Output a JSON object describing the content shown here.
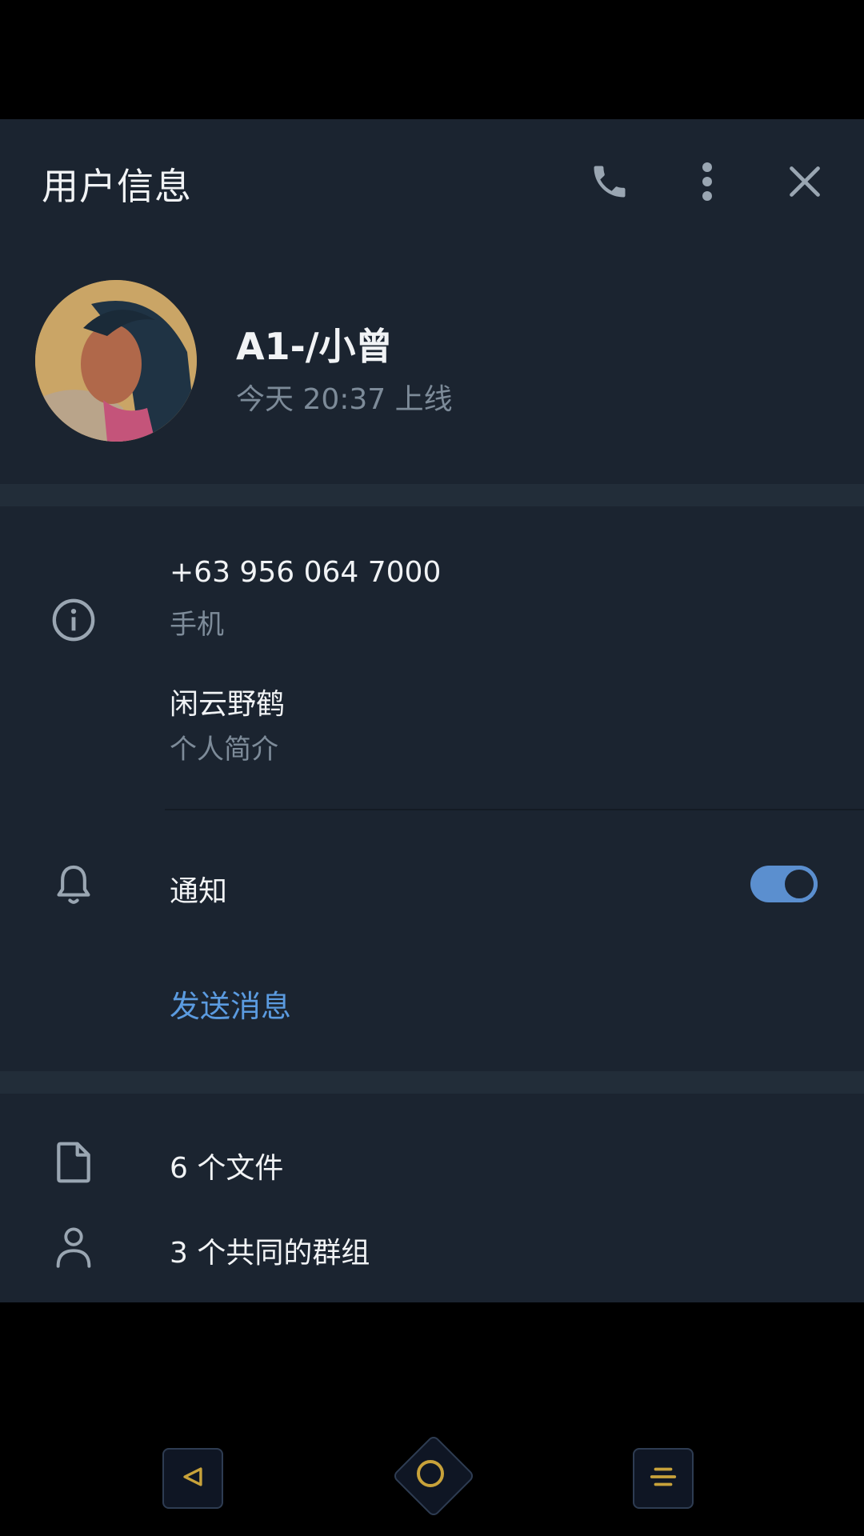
{
  "header": {
    "title": "用户信息",
    "call_icon": "phone-icon",
    "menu_icon": "more-vertical-icon",
    "close_icon": "close-icon"
  },
  "profile": {
    "name": "A1-/小曾",
    "status": "今天 20:37 上线"
  },
  "info": {
    "phone": "+63 956 064 7000",
    "phone_label": "手机",
    "bio": "闲云野鹤",
    "bio_label": "个人简介"
  },
  "notifications": {
    "label": "通知",
    "enabled": true
  },
  "send_message": "发送消息",
  "media": {
    "files": "6 个文件",
    "groups": "3 个共同的群组"
  },
  "navbar": {
    "back_icon": "back-triangle-icon",
    "home_icon": "home-circle-icon",
    "menu_icon": "menu-lines-icon"
  },
  "colors": {
    "panel_bg": "#1b2430",
    "accent": "#5b9be0",
    "toggle": "#5b8fcf",
    "nav_accent": "#c8a23a"
  }
}
